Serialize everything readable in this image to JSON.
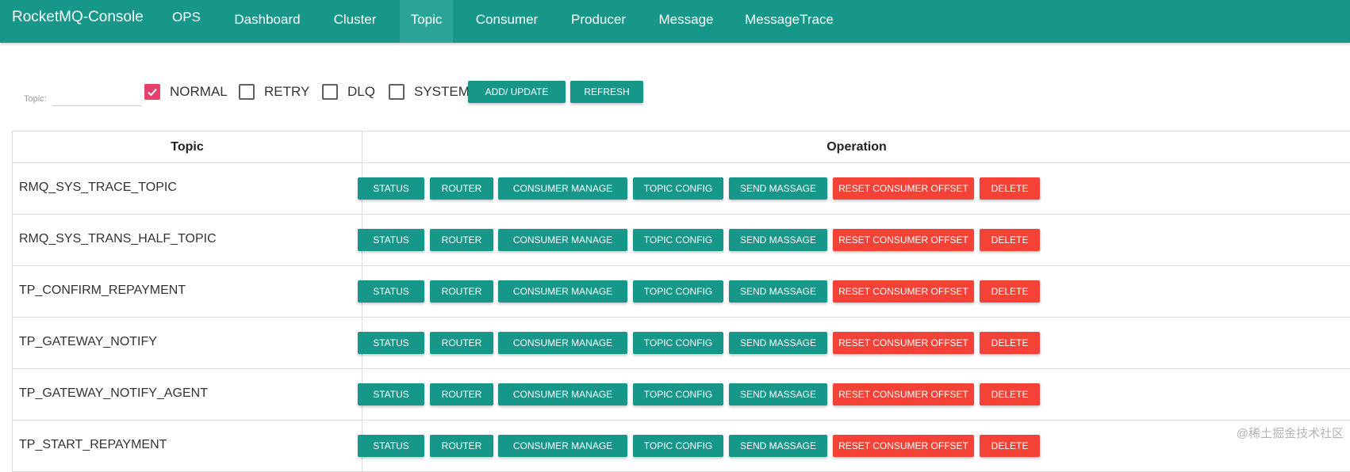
{
  "navbar": {
    "brand": "RocketMQ-Console",
    "items": [
      {
        "label": "OPS"
      },
      {
        "label": "Dashboard"
      },
      {
        "label": "Cluster"
      },
      {
        "label": "Topic",
        "active": true
      },
      {
        "label": "Consumer"
      },
      {
        "label": "Producer"
      },
      {
        "label": "Message"
      },
      {
        "label": "MessageTrace"
      }
    ]
  },
  "filter": {
    "topic_label": "Topic:",
    "topic_value": "",
    "checkboxes": [
      {
        "label": "NORMAL",
        "checked": true
      },
      {
        "label": "RETRY",
        "checked": false
      },
      {
        "label": "DLQ",
        "checked": false
      },
      {
        "label": "SYSTEM",
        "checked": false
      }
    ],
    "add_update_label": "ADD/ UPDATE",
    "refresh_label": "REFRESH"
  },
  "table": {
    "headers": {
      "topic": "Topic",
      "operation": "Operation"
    },
    "actions": [
      "STATUS",
      "ROUTER",
      "CONSUMER MANAGE",
      "TOPIC CONFIG",
      "SEND MASSAGE",
      "RESET CONSUMER OFFSET",
      "DELETE"
    ],
    "rows": [
      {
        "topic": "RMQ_SYS_TRACE_TOPIC"
      },
      {
        "topic": "RMQ_SYS_TRANS_HALF_TOPIC"
      },
      {
        "topic": "TP_CONFIRM_REPAYMENT"
      },
      {
        "topic": "TP_GATEWAY_NOTIFY"
      },
      {
        "topic": "TP_GATEWAY_NOTIFY_AGENT"
      },
      {
        "topic": "TP_START_REPAYMENT"
      }
    ]
  },
  "colors": {
    "primary": "#17978a",
    "danger": "#f44336",
    "checkbox_checked": "#e6416d"
  },
  "watermark": "@稀土掘金技术社区"
}
